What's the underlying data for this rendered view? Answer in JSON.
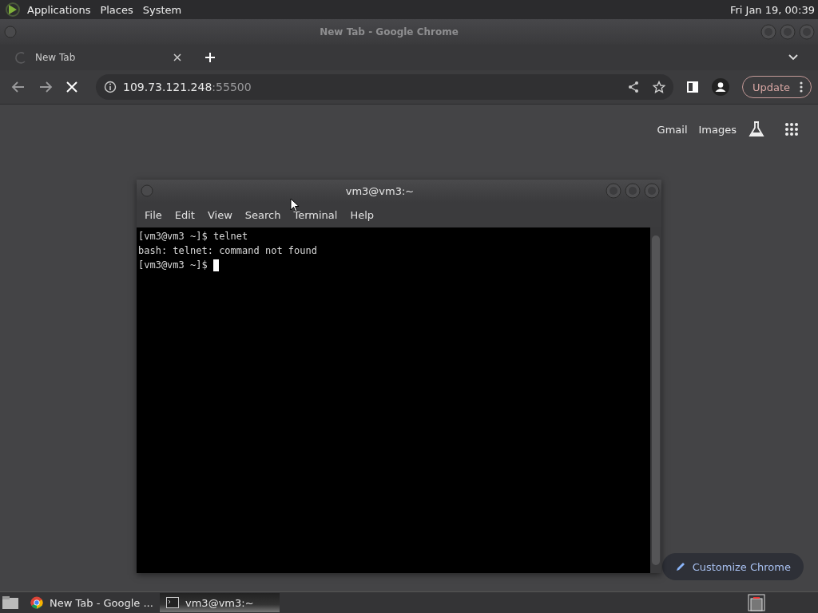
{
  "top_panel": {
    "menus": [
      "Applications",
      "Places",
      "System"
    ],
    "clock": "Fri Jan 19, 00:39"
  },
  "browser": {
    "window_title": "New Tab - Google Chrome",
    "tabs": [
      {
        "label": "New Tab",
        "loading": true
      }
    ],
    "address": {
      "host": "109.73.121.248",
      "port": ":55500"
    },
    "update_button": "Update",
    "links": [
      "Gmail",
      "Images"
    ],
    "customize_button": "Customize Chrome"
  },
  "terminal": {
    "title": "vm3@vm3:~",
    "menus": [
      "File",
      "Edit",
      "View",
      "Search",
      "Terminal",
      "Help"
    ],
    "lines": [
      "[vm3@vm3 ~]$ telnet",
      "bash: telnet: command not found",
      "[vm3@vm3 ~]$ "
    ]
  },
  "taskbar": {
    "items": [
      {
        "label": "New Tab - Google ...",
        "kind": "browser",
        "selected": false
      },
      {
        "label": "vm3@vm3:~",
        "kind": "terminal",
        "selected": true
      }
    ]
  }
}
